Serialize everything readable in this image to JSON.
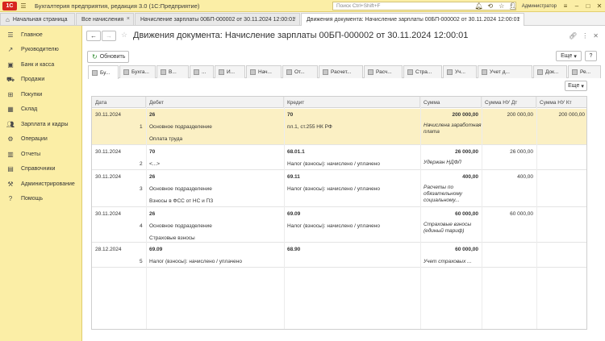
{
  "app": {
    "logo": "1С",
    "title": "Бухгалтерия предприятия, редакция 3.0  (1С:Предприятие)",
    "search_placeholder": "Поиск Ctrl+Shift+F",
    "user": "Администратор"
  },
  "tabs": [
    {
      "label": "Начальная страница"
    },
    {
      "label": "Все начисления"
    },
    {
      "label": "Начисление зарплаты 00БП-000002 от 30.11.2024 12:00:01"
    },
    {
      "label": "Движения документа: Начисление зарплаты 00БП-000002 от 30.11.2024 12:00:01"
    }
  ],
  "sidebar": {
    "items": [
      {
        "label": "Главное"
      },
      {
        "label": "Руководителю"
      },
      {
        "label": "Банк и касса"
      },
      {
        "label": "Продажи"
      },
      {
        "label": "Покупки"
      },
      {
        "label": "Склад"
      },
      {
        "label": "Зарплата и кадры"
      },
      {
        "label": "Операции"
      },
      {
        "label": "Отчеты"
      },
      {
        "label": "Справочники"
      },
      {
        "label": "Администрирование"
      },
      {
        "label": "Помощь"
      }
    ]
  },
  "header": {
    "title": "Движения документа: Начисление зарплаты 00БП-000002 от 30.11.2024 12:00:01",
    "refresh_label": "Обновить",
    "more_label": "Еще",
    "more_label2": "Еще"
  },
  "register_tabs": [
    {
      "label": "Бу..."
    },
    {
      "label": "Бухга..."
    },
    {
      "label": "В..."
    },
    {
      "label": "..."
    },
    {
      "label": "И..."
    },
    {
      "label": "Нач..."
    },
    {
      "label": "От..."
    },
    {
      "label": "Расчет..."
    },
    {
      "label": "Расч..."
    },
    {
      "label": "Стра..."
    },
    {
      "label": "Уч..."
    },
    {
      "label": "Учет д..."
    },
    {
      "label": "Док..."
    },
    {
      "label": "Ре..."
    }
  ],
  "grid": {
    "columns": [
      "Дата",
      "Дебет",
      "Кредит",
      "Сумма",
      "Сумма НУ Дт",
      "Сумма НУ Кт"
    ],
    "rows": [
      {
        "date": "30.11.2024",
        "num": "1",
        "debit": "26",
        "debit_sub1": "Основное подразделение",
        "debit_sub2": "Оплата труда",
        "credit": "70",
        "credit_sub1": "пл.1, ст.255 НК РФ",
        "sum": "200 000,00",
        "sum_note": "Начислена заработная плата",
        "nu_dt": "200 000,00",
        "nu_kt": "200 000,00"
      },
      {
        "date": "30.11.2024",
        "num": "2",
        "debit": "70",
        "debit_sub1": "<...>",
        "debit_sub2": "",
        "credit": "68.01.1",
        "credit_sub1": "Налог (взносы): начислено / уплачено",
        "sum": "26 000,00",
        "sum_note": "Удержан НДФЛ",
        "nu_dt": "26 000,00",
        "nu_kt": ""
      },
      {
        "date": "30.11.2024",
        "num": "3",
        "debit": "26",
        "debit_sub1": "Основное подразделение",
        "debit_sub2": "Взносы в ФСС от НС и ПЗ",
        "credit": "69.11",
        "credit_sub1": "Налог (взносы): начислено / уплачено",
        "sum": "400,00",
        "sum_note": "Расчеты по обязательному социальному...",
        "nu_dt": "400,00",
        "nu_kt": ""
      },
      {
        "date": "30.11.2024",
        "num": "4",
        "debit": "26",
        "debit_sub1": "Основное подразделение",
        "debit_sub2": "Страховые взносы",
        "credit": "69.09",
        "credit_sub1": "Налог (взносы): начислено / уплачено",
        "sum": "60 000,00",
        "sum_note": "Страховые взносы (единый тариф)",
        "nu_dt": "60 000,00",
        "nu_kt": ""
      },
      {
        "date": "28.12.2024",
        "num": "5",
        "debit": "69.09",
        "debit_sub1": "Налог (взносы): начислено / уплачено",
        "debit_sub2": "",
        "credit": "68.90",
        "credit_sub1": "",
        "sum": "60 000,00",
        "sum_note": "Учет страховых ...",
        "nu_dt": "",
        "nu_kt": ""
      }
    ]
  }
}
